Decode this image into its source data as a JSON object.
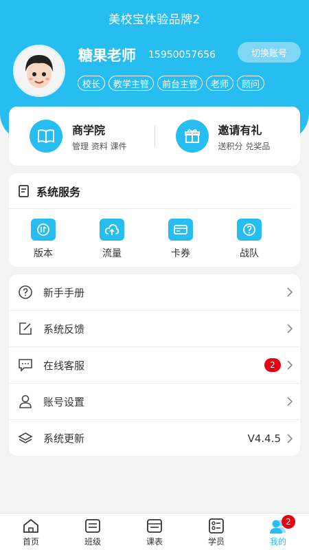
{
  "app": {
    "title": "美校宝体验品牌2"
  },
  "user": {
    "name": "糖果老师",
    "phone": "15950057656",
    "switch_label": "切换账号",
    "roles": [
      "校长",
      "教学主管",
      "前台主管",
      "老师",
      "顾问"
    ]
  },
  "quick": [
    {
      "title": "商学院",
      "sub": "管理 资料 课件",
      "icon": "book-icon"
    },
    {
      "title": "邀请有礼",
      "sub": "送积分 兑奖品",
      "icon": "gift-icon"
    }
  ],
  "services": {
    "title": "系统服务",
    "items": [
      {
        "label": "版本",
        "icon": "version-icon"
      },
      {
        "label": "流量",
        "icon": "cloud-upload-icon"
      },
      {
        "label": "卡券",
        "icon": "card-icon"
      },
      {
        "label": "战队",
        "icon": "question-icon"
      }
    ]
  },
  "menu": [
    {
      "label": "新手手册",
      "icon": "help-circle-icon"
    },
    {
      "label": "系统反馈",
      "icon": "edit-icon"
    },
    {
      "label": "在线客服",
      "icon": "chat-icon",
      "badge": "2"
    },
    {
      "label": "账号设置",
      "icon": "user-icon"
    },
    {
      "label": "系统更新",
      "icon": "layers-icon",
      "value": "V4.4.5"
    }
  ],
  "tabs": [
    {
      "label": "首页",
      "icon": "home-icon"
    },
    {
      "label": "班级",
      "icon": "class-icon"
    },
    {
      "label": "课表",
      "icon": "schedule-icon"
    },
    {
      "label": "学员",
      "icon": "student-icon"
    },
    {
      "label": "我的",
      "icon": "profile-icon",
      "badge": "2",
      "active": true
    }
  ],
  "colors": {
    "accent": "#27bdf0",
    "badge": "#e60012",
    "background": "#f3f3f3"
  }
}
